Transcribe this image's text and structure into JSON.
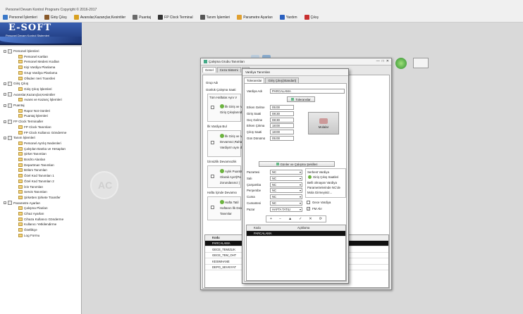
{
  "app": {
    "title": "Personel Devam Kontrol Programı Copyright © 2016-2017"
  },
  "menu": [
    {
      "label": "Personel İşlemleri",
      "icon": "people-icon",
      "color": "#3a78c8"
    },
    {
      "label": "Giriş Çıkış",
      "icon": "door-icon",
      "color": "#8a5a2a"
    },
    {
      "label": "Avanslar,Kazançlar,Kesintiler",
      "icon": "money-icon",
      "color": "#d8a020"
    },
    {
      "label": "Puantaj",
      "icon": "sheet-icon",
      "color": "#6a6a6a"
    },
    {
      "label": "FP Clock Terminal",
      "icon": "terminal-icon",
      "color": "#333333"
    },
    {
      "label": "Tanım İşlemleri",
      "icon": "definitions-icon",
      "color": "#555555"
    },
    {
      "label": "Parametre Ayarları",
      "icon": "settings-icon",
      "color": "#e0a030"
    },
    {
      "label": "Yardım",
      "icon": "help-icon",
      "color": "#2a60c0"
    },
    {
      "label": "Çıkış",
      "icon": "exit-icon",
      "color": "#c83030"
    }
  ],
  "logo": {
    "name": "E-SOFT",
    "tagline": "Personel Devam Kontrol Sistemleri"
  },
  "tree": [
    {
      "label": "Personel İşlemleri",
      "level": 0
    },
    {
      "label": "Personel Kartları",
      "level": 2
    },
    {
      "label": "Personel Medeni Kodları",
      "level": 2
    },
    {
      "label": "Kişi Vardiya Planlama",
      "level": 2
    },
    {
      "label": "Grup Vardiya Planlama",
      "level": 2
    },
    {
      "label": "Ofisden Veri Transferi",
      "level": 2
    },
    {
      "label": "Giriş Çıkış",
      "level": 0
    },
    {
      "label": "Giriş Çıkış İşlemleri",
      "level": 2
    },
    {
      "label": "Avanslar,Kazançlar,Kesintiler",
      "level": 0
    },
    {
      "label": "Avans ve Kazanç İşlemleri",
      "level": 2
    },
    {
      "label": "Puantaj",
      "level": 0
    },
    {
      "label": "Rapor Not Günleri",
      "level": 2
    },
    {
      "label": "Puantaj İşlemleri",
      "level": 2
    },
    {
      "label": "FP Clock Terminaller",
      "level": 0
    },
    {
      "label": "FP Clock Tanımları",
      "level": 2
    },
    {
      "label": "FP Clock Kullanıcı Gönderme",
      "level": 2
    },
    {
      "label": "Tanım İşlemleri",
      "level": 0
    },
    {
      "label": "Personel Ayrılış Nedenleri",
      "level": 2
    },
    {
      "label": "Çalışılan Banka ve Hesapları",
      "level": 2
    },
    {
      "label": "Şirket Tanımları",
      "level": 2
    },
    {
      "label": "Bordro Alanları",
      "level": 2
    },
    {
      "label": "Departman Tanımları",
      "level": 2
    },
    {
      "label": "Bölüm Tanımları",
      "level": 2
    },
    {
      "label": "Özel Kod Tanımları 1",
      "level": 2
    },
    {
      "label": "Özel Kod Tanımları 2",
      "level": 2
    },
    {
      "label": "İzin Tanımları",
      "level": 2
    },
    {
      "label": "Servis Tanımları",
      "level": 2
    },
    {
      "label": "Şirketten Şirkete Transfer",
      "level": 2
    },
    {
      "label": "Parametre Ayarları",
      "level": 0
    },
    {
      "label": "Çalışma Planları",
      "level": 2
    },
    {
      "label": "Cihaz Ayarları",
      "level": 2
    },
    {
      "label": "Cihaza Kullanıcı Gönderme",
      "level": 2
    },
    {
      "label": "Kullanıcı Yetkilendirme",
      "level": 2
    },
    {
      "label": "Özellikçe",
      "level": 2
    },
    {
      "label": "Log Formu",
      "level": 2
    }
  ],
  "workspace_logo": "AC",
  "win1": {
    "title": "Çalışma Grubu Tanımları",
    "tabs": [
      "Genel",
      "Ceza Sistemi",
      "A"
    ],
    "group_label": "Grup Adı",
    "section1": "Günlük Çalışma Saati",
    "section1_row": "Tüm Haftalar Aynı V",
    "opt1_line1": "İlk Giriş ve Ve",
    "opt1_line2": "Giriş Çıkışlarında",
    "section2": "İlk Vardiya Bul",
    "opt2_line1": "İlk Giriş ve V",
    "opt2_line2": "Devamsız,Raha",
    "opt2_line3": "Vardiya'n aynı d",
    "section3": "İzinsizlik Devamsızlık",
    "opt3_line1": "Aylık Puanta",
    "opt3_line2": "Olarak Ayırt(Pa",
    "opt3_line3": "Zorundasınız )",
    "section4": "Hafta İçinde Devamsı",
    "opt4_line1": "Hafta Tatil",
    "opt4_line2": "Haftanın İlk Devam",
    "opt4_line3": "Tanımlar",
    "grid_header": "Kodu",
    "grid_rows": [
      "PARCALAMA",
      "GECE_TEMIZLIK",
      "GECE_TEM_OHT",
      "KESIMHANE",
      "DEPO_SEVKIYAT"
    ]
  },
  "win2": {
    "title": "Vardiya Tanımları",
    "tabs": [
      "Toleranslar",
      "Giriş Çıkış(Standart)"
    ],
    "vardiya_label": "Vardiya Adı",
    "vardiya_value": "PARCALAMA",
    "tolerans_btn": "Toleranslar",
    "fields": [
      {
        "label": "Erken Gelme",
        "value": "05:00"
      },
      {
        "label": "Giriş Saati",
        "value": "08:30"
      },
      {
        "label": "Geç Gelme",
        "value": "08:30"
      },
      {
        "label": "Erken Çıkma",
        "value": "18:00"
      },
      {
        "label": "Çıkış Saati",
        "value": "18:00"
      },
      {
        "label": "Gün Dönümü",
        "value": "05:00"
      }
    ],
    "mola_btn": "Molalar",
    "days_btn": "Günler ve Çalışma Şekilleri",
    "days": [
      {
        "label": "Pazartesi",
        "value": "NC"
      },
      {
        "label": "Salı",
        "value": "NC"
      },
      {
        "label": "Çarşamba",
        "value": "NC"
      },
      {
        "label": "Perşembe",
        "value": "NC"
      },
      {
        "label": "Cuma",
        "value": "NC"
      },
      {
        "label": "Cumartesi",
        "value": "NC"
      },
      {
        "label": "Pazar",
        "value": "HAFTA TATILI"
      }
    ],
    "serbest_title": "Serbest Vardiya",
    "serbest_opt": "Giriş Çıkış Saatleri",
    "serbest_line1": "Belli olmayan Vardiya",
    "serbest_line2": "Parametrelerinde NC'de",
    "serbest_line3": "Mola Girmeyiniz...",
    "gece_label": "Gece Vardiya",
    "fm_label": "FM Alır",
    "nav_icons": [
      "+",
      "−",
      "▲",
      "✓",
      "✕",
      "⟳"
    ],
    "grid_headers": [
      "Kodu",
      "Açıklama"
    ],
    "grid_rows": [
      "PARCALAMA"
    ]
  }
}
